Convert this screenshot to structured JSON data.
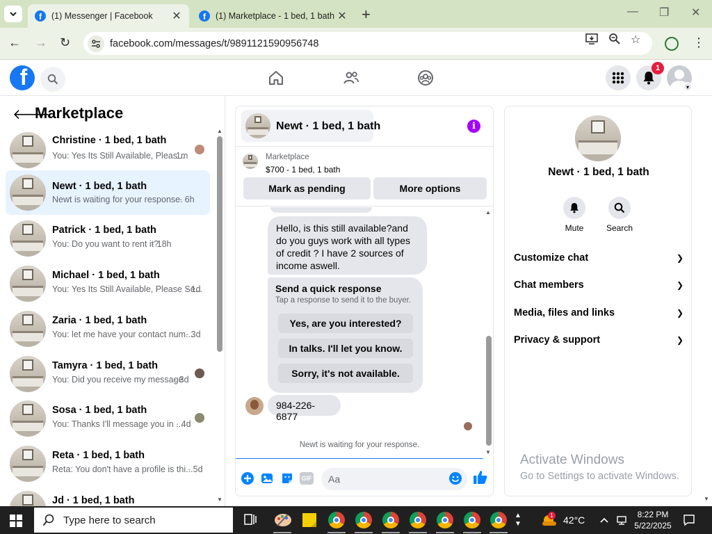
{
  "browser": {
    "tabs": [
      {
        "title": "(1) Messenger | Facebook",
        "active": true
      },
      {
        "title": "(1) Marketplace - 1 bed, 1 bath",
        "active": false
      }
    ],
    "url": "facebook.com/messages/t/9891121590956748"
  },
  "fb": {
    "notification_count": "1",
    "logo_letter": "f"
  },
  "left": {
    "title": "Marketplace",
    "conversations": [
      {
        "name": "Christine · 1 bed, 1 bath",
        "snippet": "You: Yes Its Still Available, Pleas...",
        "time": "1m",
        "selected": false
      },
      {
        "name": "Newt · 1 bed, 1 bath",
        "snippet": "Newt is waiting for your response.",
        "time": "· 6h",
        "selected": true
      },
      {
        "name": "Patrick · 1 bed, 1 bath",
        "snippet": "You: Do you want to rent it?",
        "time": "· 18h",
        "selected": false
      },
      {
        "name": "Michael · 1 bed, 1 bath",
        "snippet": "You: Yes Its Still Available, Please Se...",
        "time": "· 1d",
        "selected": false
      },
      {
        "name": "Zaria · 1 bed, 1 bath",
        "snippet": "You: let me have your contact num...",
        "time": "· 3d",
        "selected": false
      },
      {
        "name": "Tamyra · 1 bed, 1 bath",
        "snippet": "You: Did you receive my message",
        "time": "· 3d",
        "selected": false
      },
      {
        "name": "Sosa · 1 bed, 1 bath",
        "snippet": "You: Thanks I'll message you in ...",
        "time": "· 4d",
        "selected": false
      },
      {
        "name": "Reta · 1 bed, 1 bath",
        "snippet": "Reta: You don't have a profile is thi...",
        "time": "· 5d",
        "selected": false
      },
      {
        "name": "Jd · 1 bed, 1 bath",
        "snippet": "",
        "time": "",
        "selected": false
      }
    ]
  },
  "chat": {
    "title": "Newt · 1 bed, 1 bath",
    "listing_label": "Marketplace",
    "listing_price": "$700 - 1 bed, 1 bath",
    "mark_pending": "Mark as pending",
    "more_options": "More options",
    "message1": "Hello, is this still available?and do you guys work with all types of credit ? I have 2 sources of income aswell.",
    "quick_title": "Send a quick response",
    "quick_sub": "Tap a response to send it to the buyer.",
    "quick_options": [
      "Yes, are you interested?",
      "In talks. I'll let you know.",
      "Sorry, it's not available."
    ],
    "message2": "984-226-6877",
    "waiting": "Newt is waiting for your response.",
    "composer_placeholder": "Aa",
    "gif_label": "GIF"
  },
  "right": {
    "name": "Newt · 1 bed, 1 bath",
    "mute": "Mute",
    "search": "Search",
    "rows": [
      "Customize chat",
      "Chat members",
      "Media, files and links",
      "Privacy & support"
    ],
    "activate_title": "Activate Windows",
    "activate_sub": "Go to Settings to activate Windows."
  },
  "taskbar": {
    "search_placeholder": "Type here to search",
    "weather": "42°C",
    "weather_badge": "1",
    "time": "8:22 PM",
    "date": "5/22/2025"
  }
}
